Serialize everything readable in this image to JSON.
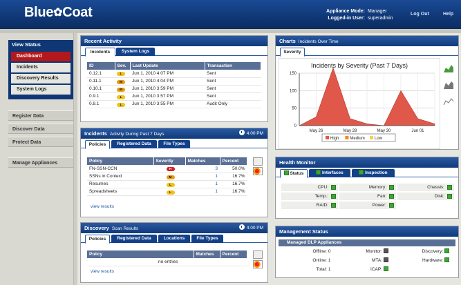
{
  "header": {
    "logo": "Blue",
    "logo_tail": "Coat",
    "appliance_mode_label": "Appliance Mode:",
    "appliance_mode": "Manager",
    "user_label": "Logged-in User:",
    "user": "superadmin",
    "logout": "Log Out",
    "help": "Help"
  },
  "sidebar": {
    "view_status": "View Status",
    "items": [
      "Dashboard",
      "Incidents",
      "Discovery Results",
      "System Logs"
    ],
    "main": [
      "Register Data",
      "Discover Data",
      "Protect Data",
      "Manage Appliances"
    ]
  },
  "recent": {
    "title": "Recent Activity",
    "tabs": [
      "Incidents",
      "System Logs"
    ],
    "cols": [
      "ID",
      "Sev.",
      "Last Update",
      "Transaction"
    ],
    "rows": [
      {
        "id": "0.12.1",
        "sev": "L",
        "update": "Jun 1, 2010 4:07 PM",
        "tx": "Sent"
      },
      {
        "id": "0.11.1",
        "sev": "M",
        "update": "Jun 1, 2010 4:04 PM",
        "tx": "Sent"
      },
      {
        "id": "0.10.1",
        "sev": "M",
        "update": "Jun 1, 2010 3:59 PM",
        "tx": "Sent"
      },
      {
        "id": "0.9.1",
        "sev": "L",
        "update": "Jun 1, 2010 3:57 PM",
        "tx": "Sent"
      },
      {
        "id": "0.8.1",
        "sev": "L",
        "update": "Jun 1, 2010 3:55 PM",
        "tx": "Audit Only"
      }
    ]
  },
  "incidents": {
    "title": "Incidents",
    "sub": "Activity During Past 7 Days",
    "time": "4:00 PM",
    "tabs": [
      "Policies",
      "Registered Data",
      "File Types"
    ],
    "cols": [
      "Policy",
      "Severity",
      "Matches",
      "Percent"
    ],
    "rows": [
      {
        "p": "FN-SSN-CCN",
        "s": "H",
        "m": "3",
        "pc": "50.0%"
      },
      {
        "p": "SSNs in Context",
        "s": "M",
        "m": "1",
        "pc": "16.7%"
      },
      {
        "p": "Resumes",
        "s": "L",
        "m": "1",
        "pc": "16.7%"
      },
      {
        "p": "Spreadsheets",
        "s": "L",
        "m": "1",
        "pc": "16.7%"
      }
    ],
    "view": "view results"
  },
  "discovery": {
    "title": "Discovery",
    "sub": "Scan Results",
    "time": "4:00 PM",
    "tabs": [
      "Policies",
      "Registered Data",
      "Locations",
      "File Types"
    ],
    "cols": [
      "Policy",
      "Matches",
      "Percent"
    ],
    "empty": "no entries",
    "view": "view results"
  },
  "charts": {
    "title": "Charts",
    "sub": "Incidents Over Time",
    "tab": "Severity"
  },
  "chart_data": {
    "type": "area",
    "title": "Incidents by Severity (Past 7 Days)",
    "x": [
      "May 25",
      "May 26",
      "May 27",
      "May 28",
      "May 29",
      "May 30",
      "May 31",
      "Jun 01",
      "Jun 02"
    ],
    "xticks": [
      "May 26",
      "May 28",
      "May 30",
      "Jun 01"
    ],
    "ylim": [
      0,
      150
    ],
    "yticks": [
      "0",
      "50",
      "100",
      "150"
    ],
    "series": [
      {
        "name": "High",
        "color": "#e0584a",
        "values": [
          0,
          25,
          165,
          20,
          5,
          0,
          100,
          20,
          5
        ]
      },
      {
        "name": "Medium",
        "color": "#f08a24",
        "values": [
          0,
          0,
          0,
          0,
          0,
          0,
          0,
          0,
          0
        ]
      },
      {
        "name": "Low",
        "color": "#f5d34a",
        "values": [
          0,
          0,
          0,
          0,
          0,
          0,
          0,
          0,
          0
        ]
      }
    ]
  },
  "health": {
    "title": "Health Monitor",
    "tabs": [
      "Status",
      "Interfaces",
      "Inspection"
    ],
    "items": [
      [
        "CPU:",
        "Memory:",
        "Chassis:"
      ],
      [
        "Temp.:",
        "Fan:",
        "Disk:"
      ],
      [
        "RAID:",
        "Power:",
        ""
      ]
    ]
  },
  "mgmt": {
    "title": "Management Status",
    "sub": "Managed DLP Appliances",
    "rows": [
      {
        "a": "Offline:",
        "av": "0",
        "b": "Monitor:",
        "bgrey": true,
        "c": "Discovery:"
      },
      {
        "a": "Online:",
        "av": "1",
        "b": "MTA:",
        "bgrey": true,
        "c": "Hardware:"
      },
      {
        "a": "Total:",
        "av": "1",
        "b": "ICAP:",
        "bgrey": false,
        "c": ""
      }
    ]
  }
}
